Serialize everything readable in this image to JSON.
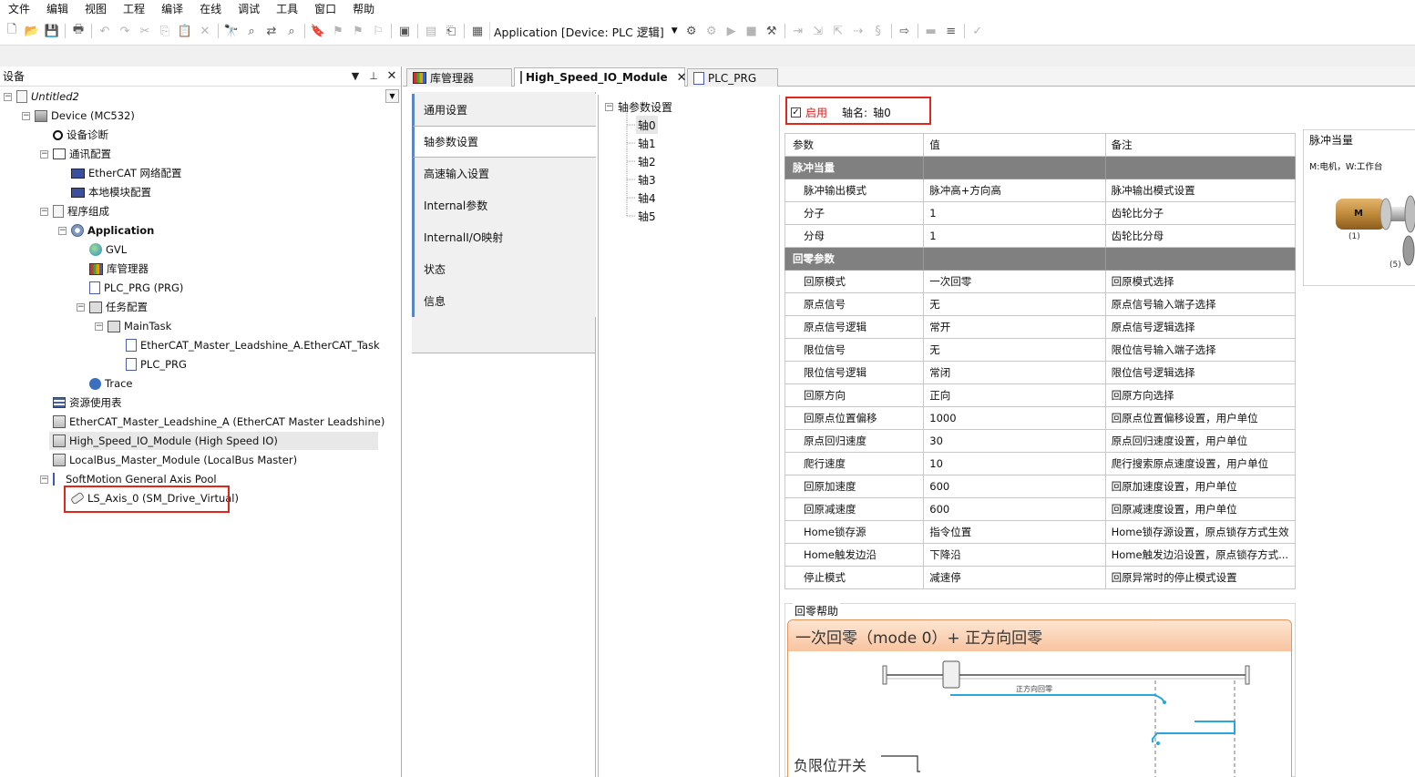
{
  "menu": [
    "文件",
    "编辑",
    "视图",
    "工程",
    "编译",
    "在线",
    "调试",
    "工具",
    "窗口",
    "帮助"
  ],
  "toolbar": {
    "app_combo": "Application [Device: PLC 逻辑]"
  },
  "device_panel": {
    "title": "设备",
    "tree": [
      {
        "label": "Untitled2",
        "italic": true
      },
      {
        "label": "Device (MC532)"
      },
      {
        "label": "设备诊断"
      },
      {
        "label": "通讯配置"
      },
      {
        "label": "EtherCAT 网络配置"
      },
      {
        "label": "本地模块配置"
      },
      {
        "label": "程序组成"
      },
      {
        "label": "Application",
        "bold": true
      },
      {
        "label": "GVL"
      },
      {
        "label": "库管理器"
      },
      {
        "label": "PLC_PRG (PRG)"
      },
      {
        "label": "任务配置"
      },
      {
        "label": "MainTask"
      },
      {
        "label": "EtherCAT_Master_Leadshine_A.EtherCAT_Task"
      },
      {
        "label": "PLC_PRG"
      },
      {
        "label": "Trace"
      },
      {
        "label": "资源使用表"
      },
      {
        "label": "EtherCAT_Master_Leadshine_A (EtherCAT Master Leadshine)"
      },
      {
        "label": "High_Speed_IO_Module (High Speed IO)"
      },
      {
        "label": "LocalBus_Master_Module (LocalBus Master)"
      },
      {
        "label": "SoftMotion General Axis Pool"
      },
      {
        "label": "LS_Axis_0 (SM_Drive_Virtual)"
      }
    ]
  },
  "tabs": [
    {
      "label": "库管理器"
    },
    {
      "label": "High_Speed_IO_Module",
      "active": true
    },
    {
      "label": "PLC_PRG"
    }
  ],
  "nav": [
    "通用设置",
    "轴参数设置",
    "高速输入设置",
    "Internal参数",
    "InternalI/O映射",
    "状态",
    "信息"
  ],
  "axis_tree": {
    "root": "轴参数设置",
    "items": [
      "轴0",
      "轴1",
      "轴2",
      "轴3",
      "轴4",
      "轴5"
    ]
  },
  "axis_header": {
    "enable_label": "启用",
    "axis_name_label": "轴名:",
    "axis_name_value": "轴0"
  },
  "params": {
    "headers": [
      "参数",
      "值",
      "备注"
    ],
    "rows": [
      {
        "group": "脉冲当量"
      },
      {
        "name": "脉冲输出模式",
        "value": "脉冲高+方向高",
        "note": "脉冲输出模式设置"
      },
      {
        "name": "分子",
        "value": "1",
        "note": "齿轮比分子"
      },
      {
        "name": "分母",
        "value": "1",
        "note": "齿轮比分母"
      },
      {
        "group": "回零参数"
      },
      {
        "name": "回原模式",
        "value": "一次回零",
        "note": "回原模式选择"
      },
      {
        "name": "原点信号",
        "value": "无",
        "note": "原点信号输入端子选择"
      },
      {
        "name": "原点信号逻辑",
        "value": "常开",
        "note": "原点信号逻辑选择"
      },
      {
        "name": "限位信号",
        "value": "无",
        "note": "限位信号输入端子选择"
      },
      {
        "name": "限位信号逻辑",
        "value": "常闭",
        "note": "限位信号逻辑选择"
      },
      {
        "name": "回原方向",
        "value": "正向",
        "note": "回原方向选择"
      },
      {
        "name": "回原点位置偏移",
        "value": "1000",
        "note": "回原点位置偏移设置，用户单位"
      },
      {
        "name": "原点回归速度",
        "value": "30",
        "note": "原点回归速度设置，用户单位"
      },
      {
        "name": "爬行速度",
        "value": "10",
        "note": "爬行搜索原点速度设置，用户单位"
      },
      {
        "name": "回原加速度",
        "value": "600",
        "note": "回原加速度设置，用户单位"
      },
      {
        "name": "回原减速度",
        "value": "600",
        "note": "回原减速度设置，用户单位"
      },
      {
        "name": "Home锁存源",
        "value": "指令位置",
        "note": "Home锁存源设置，原点锁存方式生效"
      },
      {
        "name": "Home触发边沿",
        "value": "下降沿",
        "note": "Home触发边沿设置，原点锁存方式..."
      },
      {
        "name": "停止模式",
        "value": "减速停",
        "note": "回原异常时的停止模式设置"
      }
    ]
  },
  "pulse_panel": {
    "title": "脉冲当量",
    "subtitle": "M:电机，W:工作台",
    "motor": "M",
    "label1": "(1)",
    "label5": "(5)"
  },
  "home_help": {
    "title": "回零帮助",
    "banner": "一次回零（mode 0）+ 正方向回零",
    "arrow_label": "正方向回零",
    "neg_limit": "负限位开关"
  },
  "colors": {
    "accent": "#5a86c8",
    "highlight_box": "#e0271e",
    "group_row": "#808080",
    "banner": "#f8c49f",
    "trace_line": "#29a6dc"
  }
}
